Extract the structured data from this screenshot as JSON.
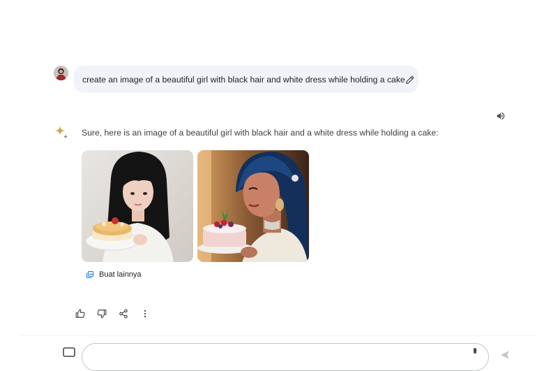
{
  "prompt": {
    "text": "create an image of a beautiful girl with black hair and white dress while holding a cake"
  },
  "response": {
    "text": "Sure, here is an image of a beautiful girl with black hair and a white dress while holding a cake:",
    "more_button_label": "Buat lainnya"
  },
  "input": {
    "placeholder": ""
  },
  "icons": {
    "edit": "pencil-icon",
    "speaker": "speaker-icon",
    "assistant": "sparkle-icon",
    "more": "image-stack-icon",
    "thumbs_up": "thumbs-up-icon",
    "thumbs_down": "thumbs-down-icon",
    "share": "share-icon",
    "menu": "more-vert-icon"
  },
  "colors": {
    "bubble": "#f0f4f9",
    "icon": "#444746",
    "text": "#1f1f1f"
  }
}
